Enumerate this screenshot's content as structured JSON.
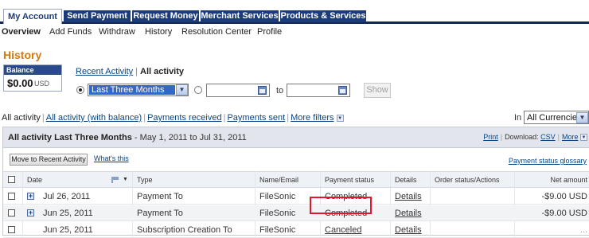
{
  "tabs": [
    "My Account",
    "Send Payment",
    "Request Money",
    "Merchant Services",
    "Products & Services"
  ],
  "subnav": [
    "Overview",
    "Add Funds",
    "Withdraw",
    "History",
    "Resolution Center",
    "Profile"
  ],
  "page_title": "History",
  "balance": {
    "label": "Balance",
    "amount": "$0.00",
    "currency": "USD"
  },
  "view": {
    "recent": "Recent Activity",
    "all": "All activity"
  },
  "date_filter": {
    "range_value": "Last Three Months",
    "to_label": "to",
    "from_value": "",
    "to_value": "",
    "show_label": "Show"
  },
  "filters": {
    "all": "All activity",
    "all_with_balance": "All activity (with balance)",
    "received": "Payments received",
    "sent": "Payments sent",
    "more": "More filters"
  },
  "currency": {
    "label": "In",
    "value": "All Currencies"
  },
  "panel": {
    "title_bold": "All activity Last Three Months",
    "title_range": " - May 1, 2011 to Jul 31, 2011",
    "print": "Print",
    "download_label": "Download:",
    "download_format": "CSV",
    "more": "More",
    "move_button": "Move to Recent Activity",
    "whats_this": "What's this",
    "glossary": "Payment status glossary"
  },
  "columns": [
    "Date",
    "Type",
    "Name/Email",
    "Payment status",
    "Details",
    "Order status/Actions",
    "Net amount"
  ],
  "rows": [
    {
      "date": "Jul 26, 2011",
      "type": "Payment To",
      "name": "FileSonic",
      "status": "Completed",
      "details": "Details",
      "order": "",
      "amount": "-$9.00 USD"
    },
    {
      "date": "Jun 25, 2011",
      "type": "Payment To",
      "name": "FileSonic",
      "status": "Completed",
      "details": "Details",
      "order": "",
      "amount": "-$9.00 USD"
    },
    {
      "date": "Jun 25, 2011",
      "type": "Subscription Creation To",
      "name": "FileSonic",
      "status": "Canceled",
      "details": "Details",
      "order": "",
      "amount": "..."
    }
  ],
  "colors": {
    "tab_bg": "#1b3c79",
    "title_orange": "#d47a0f",
    "link": "#084482",
    "highlight": "#e8142d"
  }
}
